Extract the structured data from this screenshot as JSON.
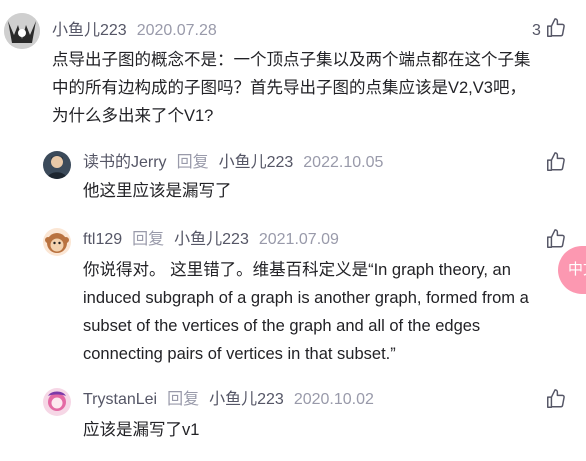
{
  "comments": [
    {
      "author": "小鱼儿223",
      "date": "2020.07.28",
      "likes": "3",
      "lines": [
        "点导出子图的概念不是：一个顶点子集以及两个端点都在这个子集",
        "中的所有边构成的子图吗？首先导出子图的点集应该是V2,V3吧，",
        "为什么多出来了个V1?"
      ]
    }
  ],
  "replies": [
    {
      "author": "读书的Jerry",
      "reply_label": "回复",
      "target": "小鱼儿223",
      "date": "2022.10.05",
      "lines": [
        "他这里应该是漏写了"
      ]
    },
    {
      "author": "ftl129",
      "reply_label": "回复",
      "target": "小鱼儿223",
      "date": "2021.07.09",
      "lines": [
        "你说得对。 这里错了。维基百科定义是“In graph theory, an",
        "induced subgraph of a graph is another graph, formed from a",
        "subset of the vertices of the graph and all of the edges",
        "connecting pairs of vertices in that subset.”"
      ]
    },
    {
      "author": "TrystanLei",
      "reply_label": "回复",
      "target": "小鱼儿223",
      "date": "2020.10.02",
      "lines": [
        "应该是漏写了v1"
      ]
    }
  ],
  "floating_button": {
    "label": "中文"
  },
  "colors": {
    "text": "#222226",
    "meta": "#555666",
    "muted": "#999aaa",
    "badge": "#fc98b1"
  }
}
